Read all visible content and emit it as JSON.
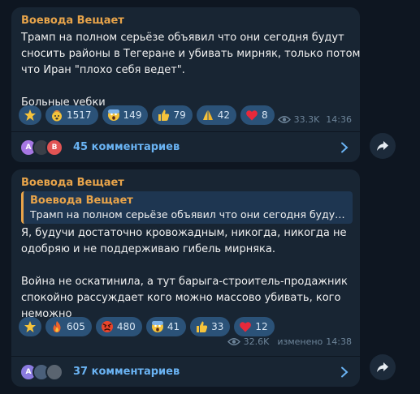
{
  "posts": [
    {
      "author": "Воевода Вещает",
      "lines": [
        "Трамп на полном серьёзе объявил что они сегодня будут",
        "сносить районы в Тегеране и убивать мирняк, только потому,",
        "что Иран \"плохо себя ведет\".",
        "",
        "Больные уебки"
      ],
      "reactions": [
        {
          "emoji": "star-icon",
          "count": ""
        },
        {
          "emoji": "mindblown-icon",
          "count": "1517"
        },
        {
          "emoji": "scream-icon",
          "count": "149"
        },
        {
          "emoji": "thumbs-up-icon",
          "count": "79"
        },
        {
          "emoji": "pray-icon",
          "count": "42"
        },
        {
          "emoji": "heart-icon",
          "count": "8"
        }
      ],
      "views": "33.3K",
      "edited": "",
      "time": "14:36",
      "comments_label": "45 комментариев",
      "avatars": [
        {
          "letter": "A",
          "color": "#a777e3"
        },
        {
          "letter": "",
          "color": "#3a3f48"
        },
        {
          "letter": "B",
          "color": "#e25454"
        }
      ]
    },
    {
      "author": "Воевода Вещает",
      "quote": {
        "author": "Воевода Вещает",
        "text": "Трамп на полном серьёзе объявил что они сегодня будут сн..."
      },
      "lines": [
        "Я, будучи достаточно кровожадным, никогда, никогда не",
        "одобряю и не поддерживаю гибель мирняка.",
        "",
        "Война не оскатинила, а тут барыга-строитель-продажник",
        "спокойно рассуждает кого можно массово убивать, кого",
        "неможно"
      ],
      "reactions": [
        {
          "emoji": "star-icon",
          "count": ""
        },
        {
          "emoji": "fire-icon",
          "count": "605"
        },
        {
          "emoji": "angry-icon",
          "count": "480"
        },
        {
          "emoji": "scream-icon",
          "count": "41"
        },
        {
          "emoji": "thumbs-up-icon",
          "count": "33"
        },
        {
          "emoji": "heart-icon",
          "count": "12"
        }
      ],
      "views": "32.6K",
      "edited": "изменено",
      "time": "14:38",
      "comments_label": "37 комментариев",
      "avatars": [
        {
          "letter": "A",
          "color": "#8b7be0"
        },
        {
          "letter": "",
          "color": "#4a5f7a"
        },
        {
          "letter": "",
          "color": "#5a6470"
        }
      ]
    }
  ],
  "colors": {
    "background": "#0e1621",
    "bubble": "#182533",
    "author": "#e8a44a",
    "link": "#6ab3f3",
    "reaction_bg": "#2b5278"
  }
}
